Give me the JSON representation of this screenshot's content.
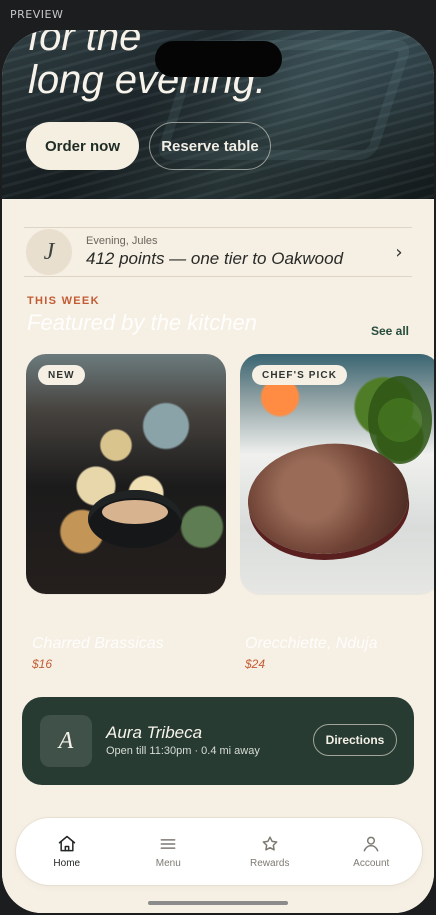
{
  "frame": {
    "label": "PREVIEW"
  },
  "hero": {
    "title": "for the\nlong evening.",
    "actions": {
      "order": "Order now",
      "reserve": "Reserve table"
    }
  },
  "loyalty": {
    "avatar_letter": "J",
    "greeting": "Evening, Jules",
    "points": "412 points — one tier to Oakwood",
    "chevron": "›"
  },
  "featured": {
    "eyebrow": "THIS WEEK",
    "title": "Featured by the kitchen",
    "see_all": "See all",
    "cards": [
      {
        "badge": "NEW",
        "name": "Charred Brassicas",
        "price": "$16"
      },
      {
        "badge": "CHEF'S PICK",
        "name": "Orecchiette, Nduja",
        "price": "$24"
      }
    ]
  },
  "location": {
    "avatar_letter": "A",
    "name": "Aura Tribeca",
    "meta": "Open till 11:30pm · 0.4 mi away",
    "directions": "Directions"
  },
  "nav": {
    "items": [
      {
        "label": "Home",
        "icon": "home-icon",
        "active": true
      },
      {
        "label": "Menu",
        "icon": "menu-icon",
        "active": false
      },
      {
        "label": "Rewards",
        "icon": "star-icon",
        "active": false
      },
      {
        "label": "Account",
        "icon": "user-icon",
        "active": false
      }
    ]
  },
  "colors": {
    "accent": "#c35c35",
    "dark_green": "#273b32",
    "cream": "#f6efe4"
  }
}
